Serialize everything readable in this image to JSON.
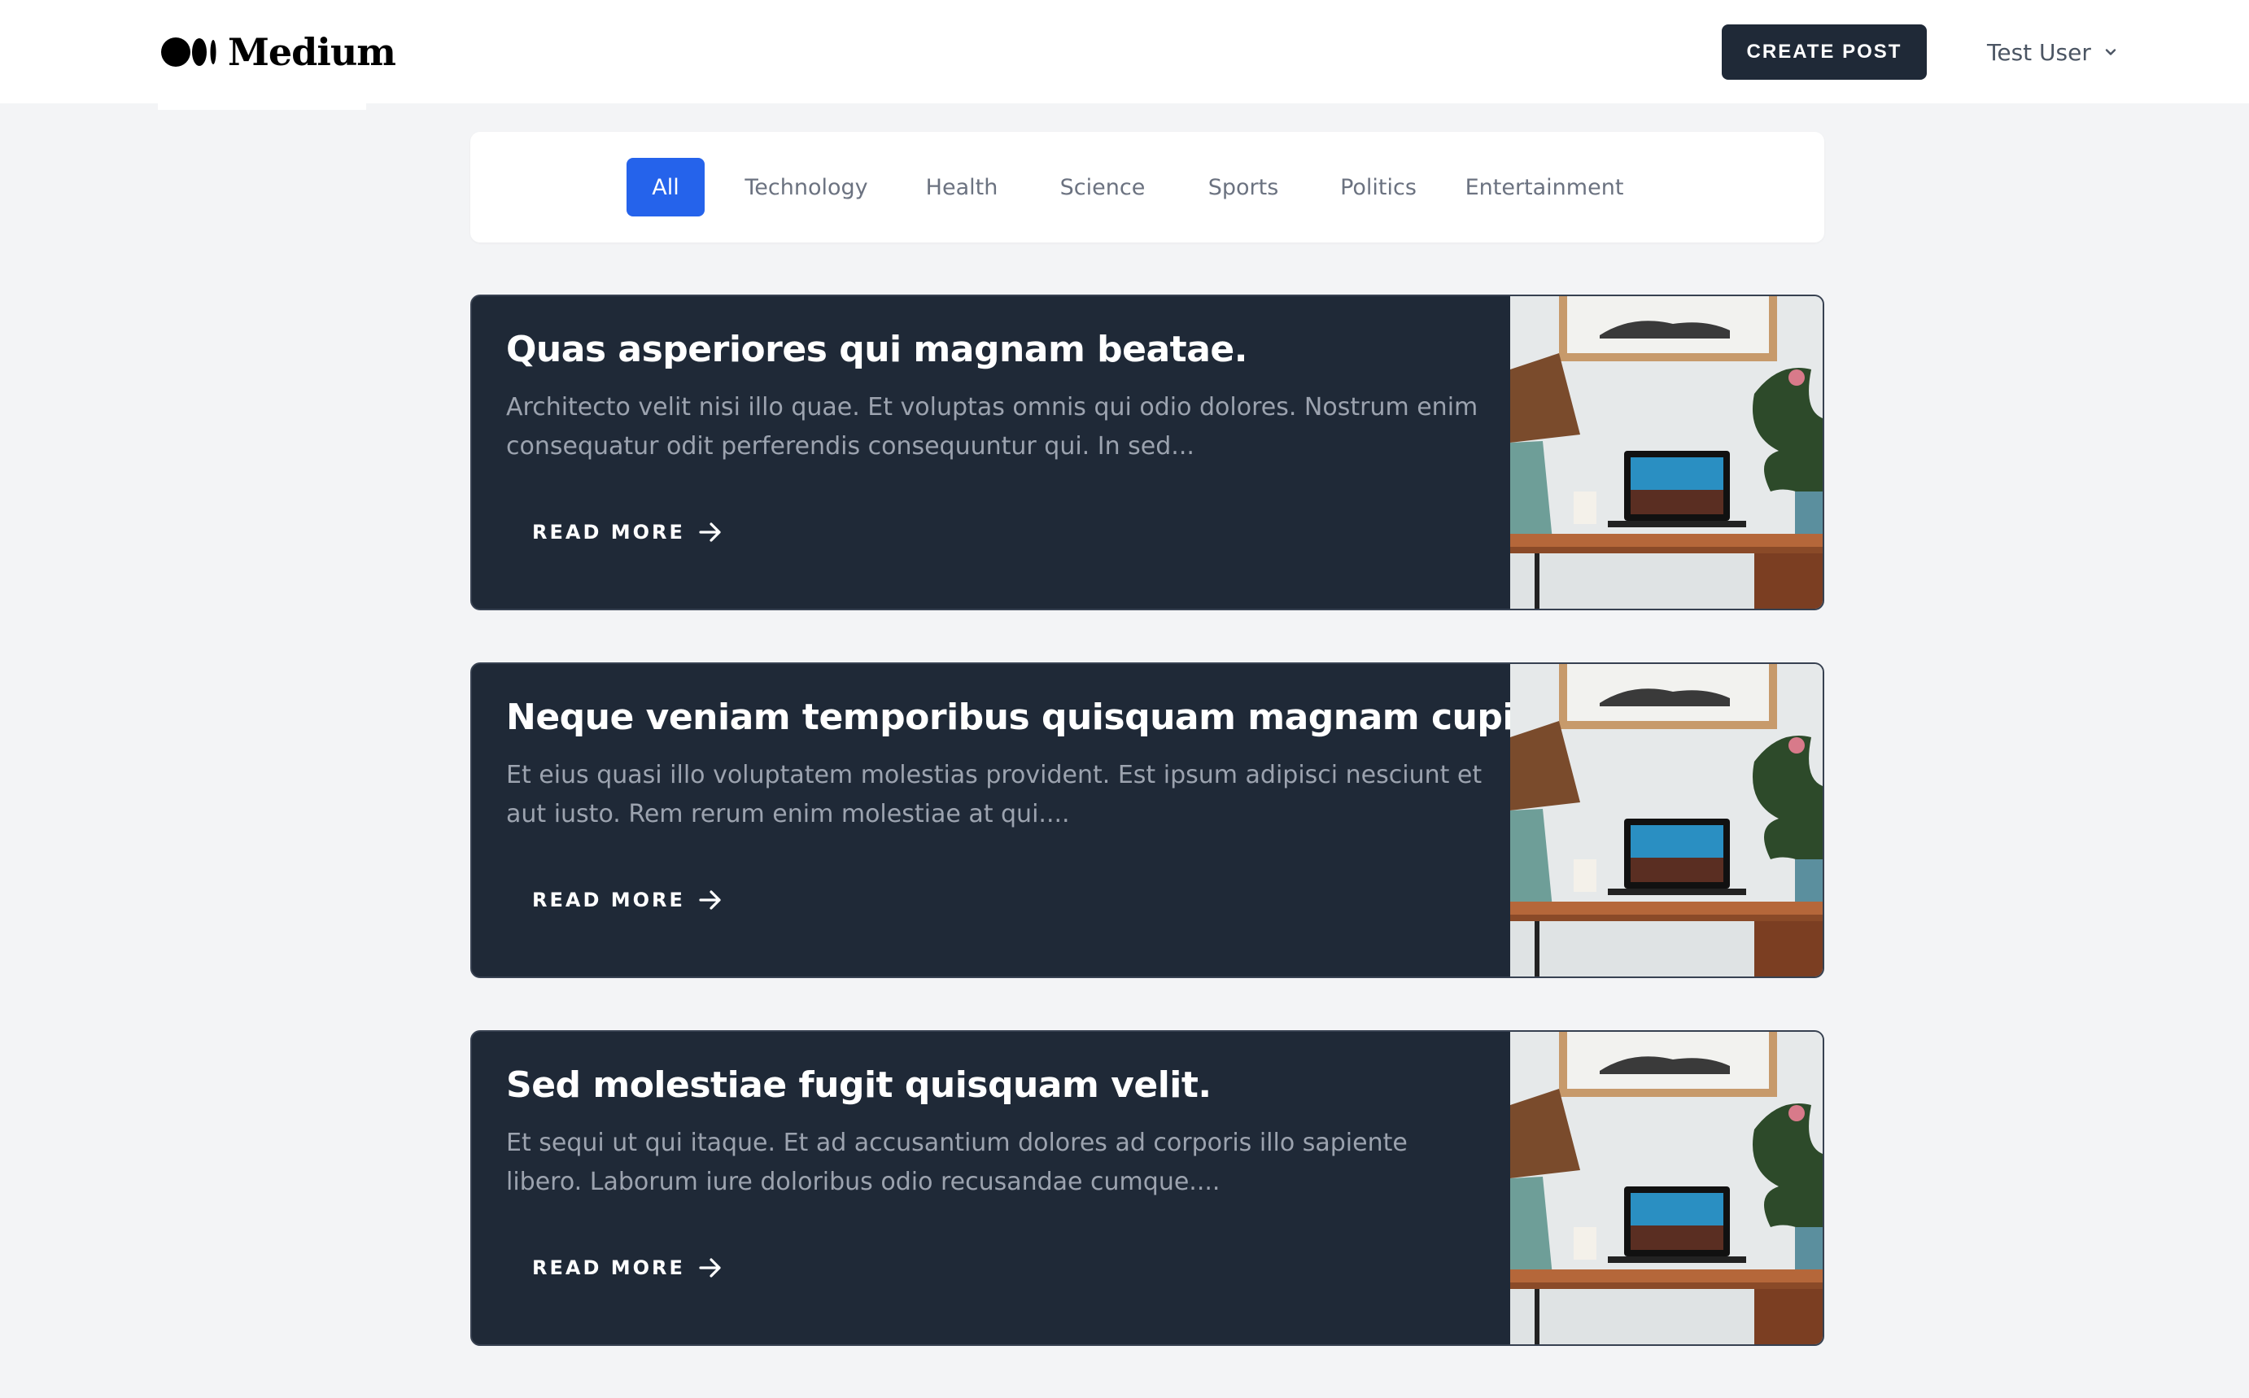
{
  "header": {
    "logo_text": "Medium",
    "create_button_label": "CREATE POST",
    "user_name": "Test User"
  },
  "categories": {
    "active": "All",
    "items": [
      "All",
      "Technology",
      "Health",
      "Science",
      "Sports",
      "Politics",
      "Entertainment"
    ]
  },
  "articles": [
    {
      "title": "Quas asperiores qui magnam beatae.",
      "excerpt": "Architecto velit nisi illo quae. Et voluptas omnis qui odio dolores. Nostrum enim consequatur odit perferendis consequuntur qui. In sed...",
      "read_more_label": "READ MORE"
    },
    {
      "title": "Neque veniam temporibus quisquam magnam cupiditate.",
      "excerpt": "Et eius quasi illo voluptatem molestias provident. Est ipsum adipisci nesciunt et aut iusto. Rem rerum enim molestiae at qui....",
      "read_more_label": "READ MORE"
    },
    {
      "title": "Sed molestiae fugit quisquam velit.",
      "excerpt": "Et sequi ut qui itaque. Et ad accusantium dolores ad corporis illo sapiente libero. Laborum iure doloribus odio recusandae cumque....",
      "read_more_label": "READ MORE"
    }
  ],
  "colors": {
    "accent": "#2563eb",
    "card_background": "#1f2937",
    "page_background": "#f3f4f6"
  }
}
